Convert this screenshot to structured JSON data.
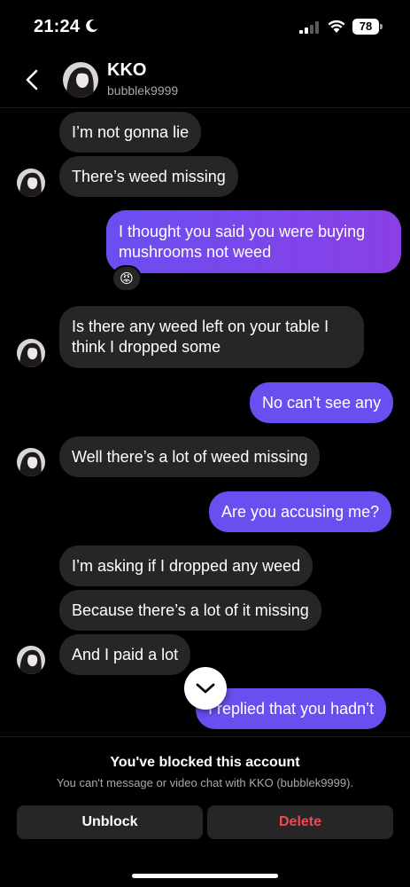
{
  "status_bar": {
    "time": "21:24",
    "battery": "78",
    "icons": [
      "moon-icon",
      "signal-icon",
      "wifi-icon",
      "battery-icon"
    ]
  },
  "header": {
    "name": "KKO",
    "handle": "bubblek9999",
    "back_icon": "chevron-left-icon"
  },
  "messages": [
    {
      "sender": "them",
      "text": "I’m not gonna lie"
    },
    {
      "sender": "them",
      "text": "There’s weed missing"
    },
    {
      "sender": "me",
      "text": "I thought you said you were buying mushrooms not weed",
      "reaction": "😡"
    },
    {
      "sender": "them",
      "text": "Is there any weed left on your table I think I dropped some"
    },
    {
      "sender": "me",
      "text": "No can’t see any"
    },
    {
      "sender": "them",
      "text": "Well there’s a lot of weed missing"
    },
    {
      "sender": "me",
      "text": "Are you accusing me?"
    },
    {
      "sender": "them",
      "text": "I’m asking if I dropped any weed"
    },
    {
      "sender": "them",
      "text": "Because there’s a lot of it missing"
    },
    {
      "sender": "them",
      "text": "And I paid a lot"
    },
    {
      "sender": "me",
      "text": "I replied that you hadn’t"
    }
  ],
  "blocked": {
    "title": "You've blocked this account",
    "subtitle": "You can't message or video chat with KKO (bubblek9999).",
    "unblock_label": "Unblock",
    "delete_label": "Delete"
  },
  "colors": {
    "background": "#000000",
    "incoming_bubble": "#262626",
    "outgoing_bubble": "#6a4ef0",
    "delete_text": "#ed4956",
    "secondary_text": "#a8a8a8"
  }
}
